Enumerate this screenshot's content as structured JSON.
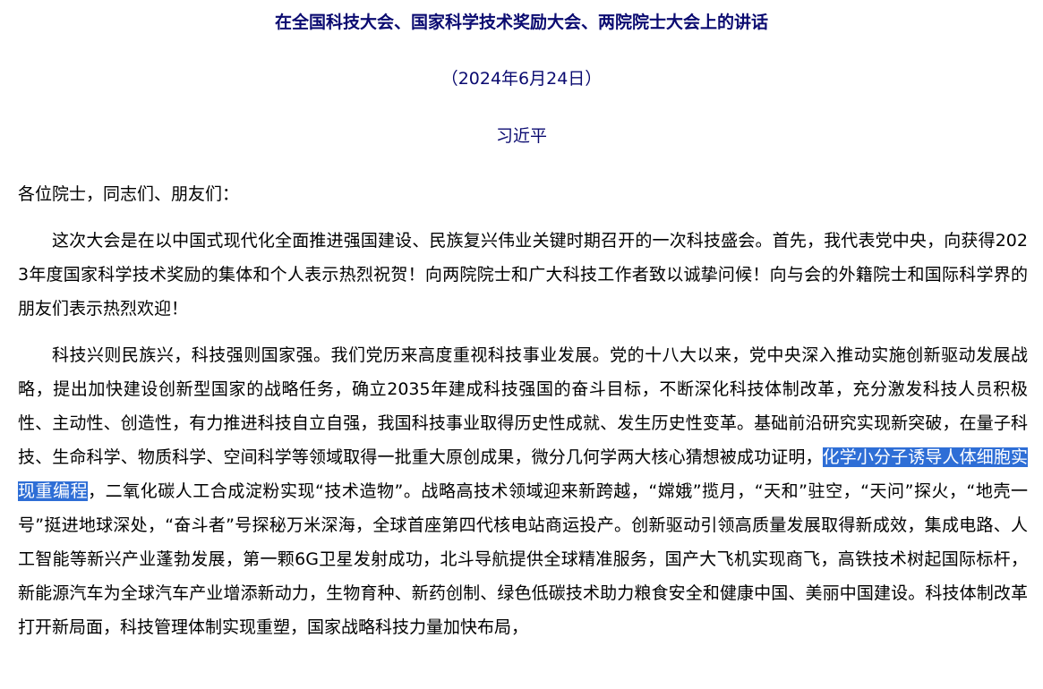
{
  "document": {
    "title": "在全国科技大会、国家科学技术奖励大会、两院院士大会上的讲话",
    "date": "（2024年6月24日）",
    "author": "习近平",
    "salutation": "各位院士，同志们、朋友们：",
    "paragraph1": "这次大会是在以中国式现代化全面推进强国建设、民族复兴伟业关键时期召开的一次科技盛会。首先，我代表党中央，向获得2023年度国家科学技术奖励的集体和个人表示热烈祝贺！向两院院士和广大科技工作者致以诚挚问候！向与会的外籍院士和国际科学界的朋友们表示热烈欢迎！",
    "paragraph2_before": "科技兴则民族兴，科技强则国家强。我们党历来高度重视科技事业发展。党的十八大以来，党中央深入推动实施创新驱动发展战略，提出加快建设创新型国家的战略任务，确立2035年建成科技强国的奋斗目标，不断深化科技体制改革，充分激发科技人员积极性、主动性、创造性，有力推进科技自立自强，我国科技事业取得历史性成就、发生历史性变革。基础前沿研究实现新突破，在量子科技、生命科学、物质科学、空间科学等领域取得一批重大原创成果，微分几何学两大核心猜想被成功证明，",
    "paragraph2_selected": "化学小分子诱导人体细胞实现重编程",
    "paragraph2_after": "，二氧化碳人工合成淀粉实现“技术造物”。战略高技术领域迎来新跨越，“嫦娥”揽月，“天和”驻空，“天问”探火，“地壳一号”挺进地球深处，“奋斗者”号探秘万米深海，全球首座第四代核电站商运投产。创新驱动引领高质量发展取得新成效，集成电路、人工智能等新兴产业蓬勃发展，第一颗6G卫星发射成功，北斗导航提供全球精准服务，国产大飞机实现商飞，高铁技术树起国际标杆，新能源汽车为全球汽车产业增添新动力，生物育种、新药创制、绿色低碳技术助力粮食安全和健康中国、美丽中国建设。科技体制改革打开新局面，科技管理体制实现重塑，国家战略科技力量加快布局，"
  },
  "colors": {
    "heading": "#0a0a70",
    "selection_bg": "#2e6ed6",
    "selection_text": "#ffffff"
  }
}
